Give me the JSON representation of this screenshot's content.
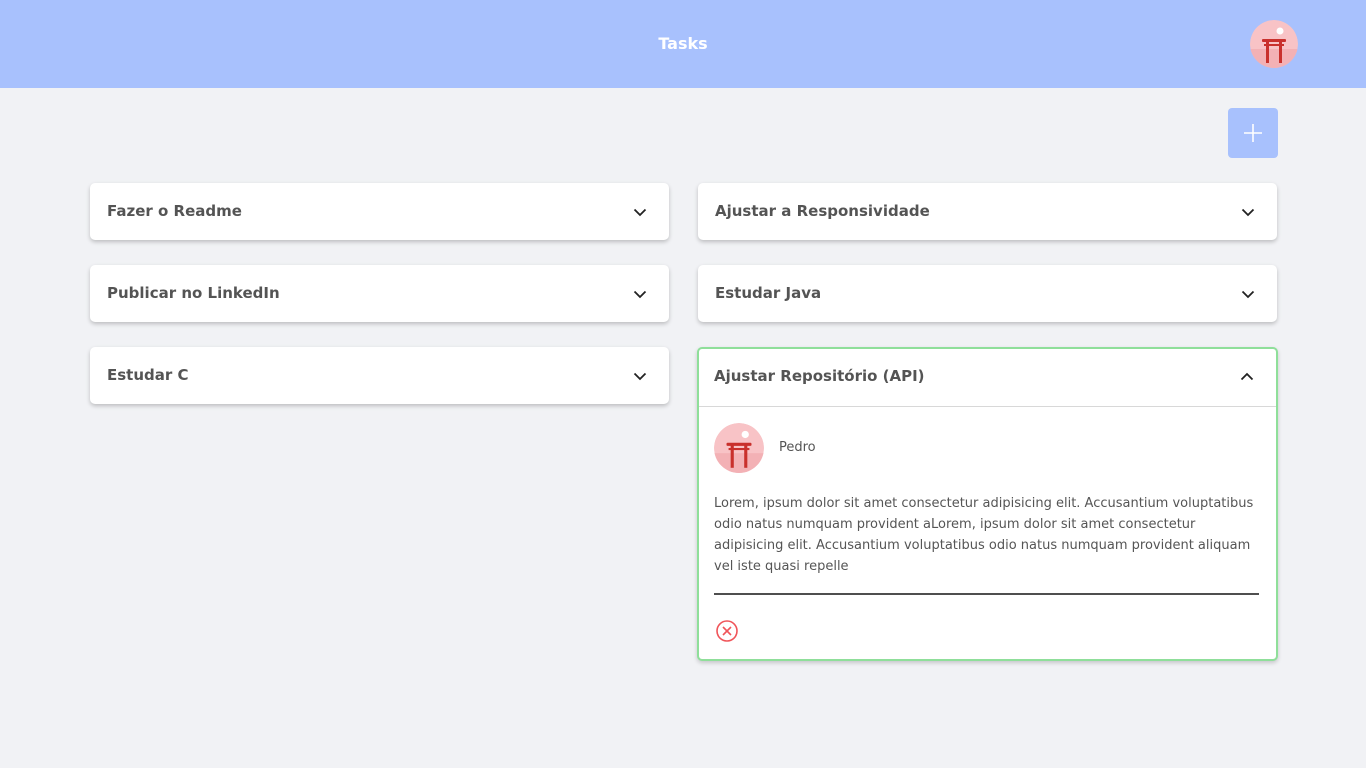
{
  "header": {
    "title": "Tasks",
    "avatar_icon": "torii-gate-avatar-icon",
    "background_color": "#a8c1fd"
  },
  "toolbar": {
    "add_icon": "plus-icon"
  },
  "tasks": [
    {
      "title": "Fazer o Readme",
      "expanded": false
    },
    {
      "title": "Ajustar a Responsividade",
      "expanded": false
    },
    {
      "title": "Publicar no LinkedIn",
      "expanded": false
    },
    {
      "title": "Estudar Java",
      "expanded": false
    },
    {
      "title": "Estudar C",
      "expanded": false
    },
    {
      "title": "Ajustar Repositório (API)",
      "expanded": true,
      "author": "Pedro",
      "description": "Lorem, ipsum dolor sit amet consectetur adipisicing elit. Accusantium voluptatibus odio natus numquam provident aLorem, ipsum dolor sit amet consectetur adipisicing elit. Accusantium voluptatibus odio natus numquam provident aliquam vel iste quasi repelle"
    }
  ],
  "colors": {
    "accent": "#a8c1fd",
    "expanded_border": "#8fdf9a",
    "delete": "#f0555a",
    "page_background": "#f1f2f5"
  }
}
